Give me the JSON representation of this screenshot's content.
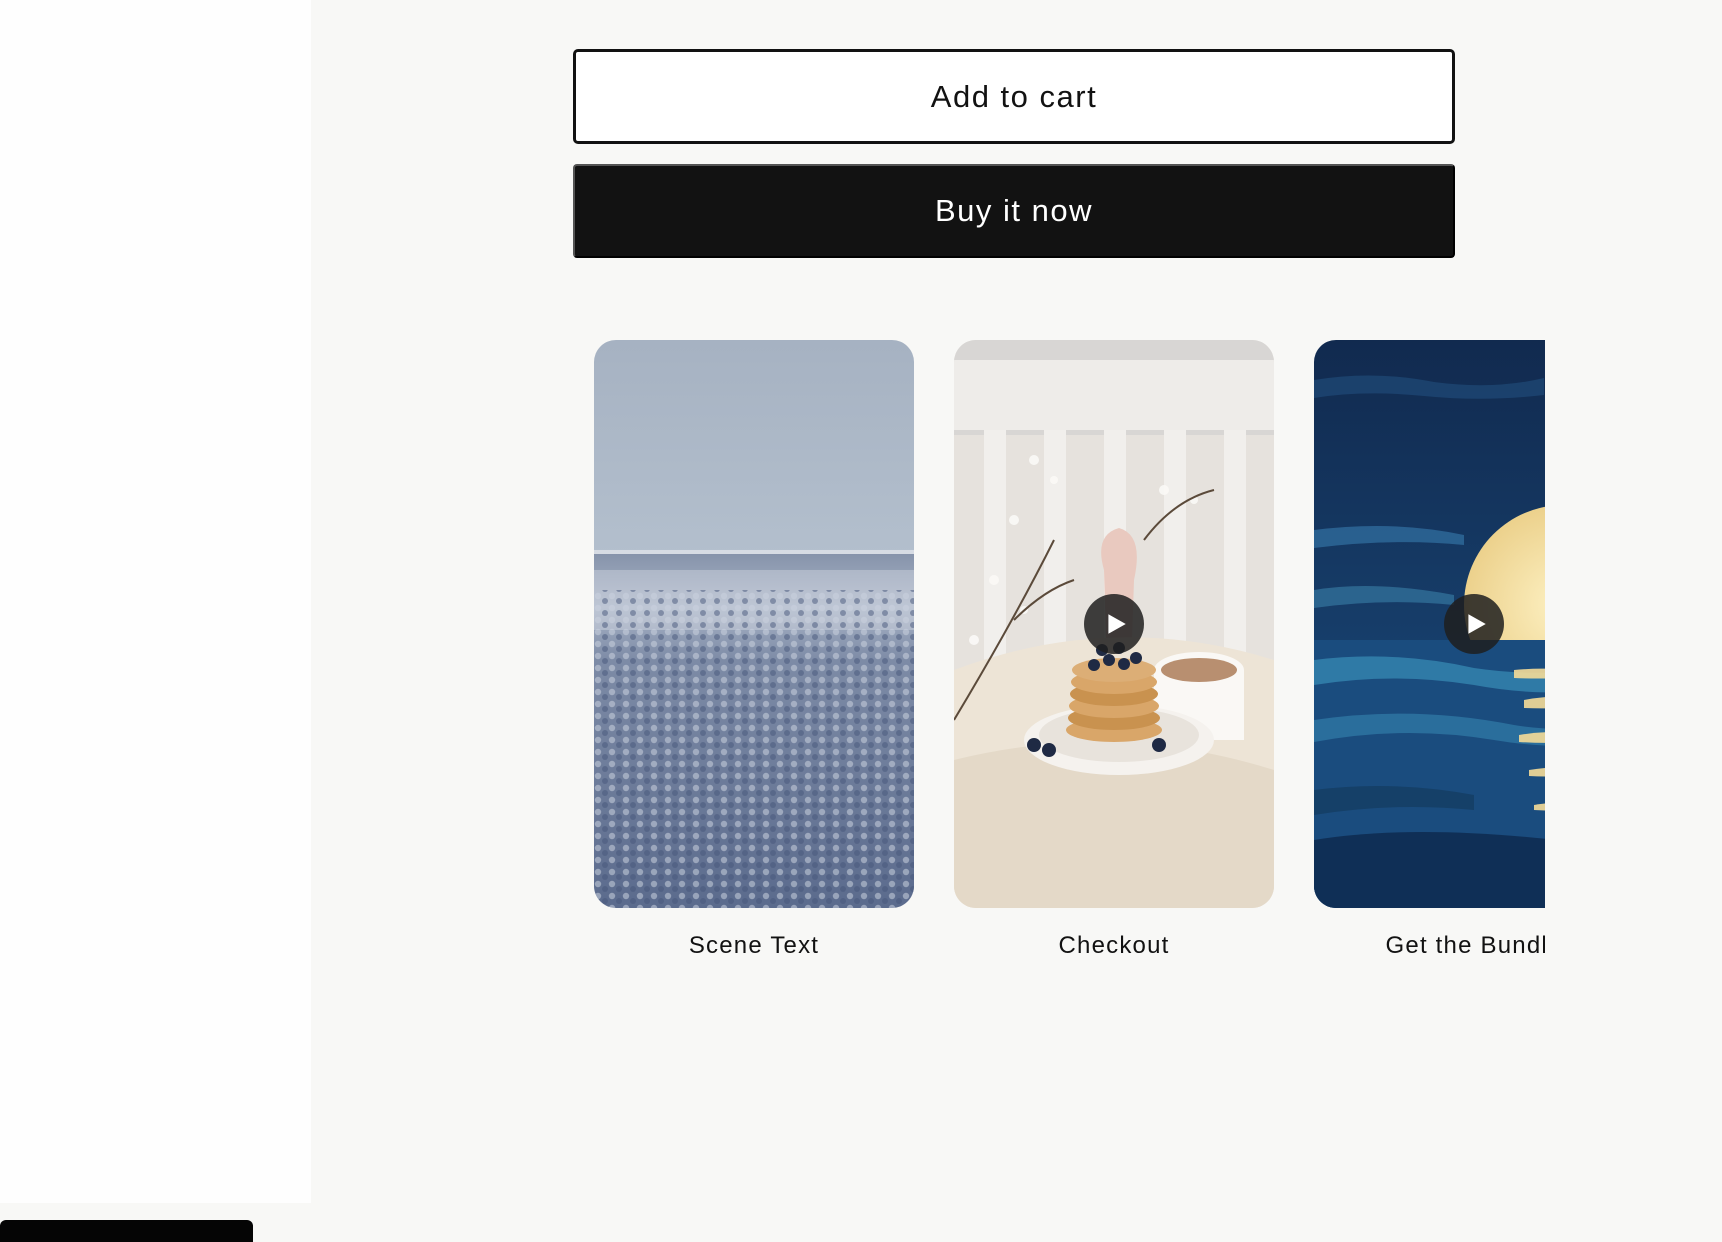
{
  "buttons": {
    "add_to_cart": "Add to cart",
    "buy_now": "Buy it now"
  },
  "video_cards": [
    {
      "caption": "Scene Text",
      "image": "snowy-forest-landscape",
      "has_play": false
    },
    {
      "caption": "Checkout",
      "image": "pancakes-breakfast",
      "has_play": true
    },
    {
      "caption": "Get the Bundle",
      "image": "moon-over-ocean-illustration",
      "has_play": true
    }
  ],
  "colors": {
    "page_bg": "#f8f8f6",
    "button_dark": "#121212",
    "button_light": "#ffffff"
  }
}
